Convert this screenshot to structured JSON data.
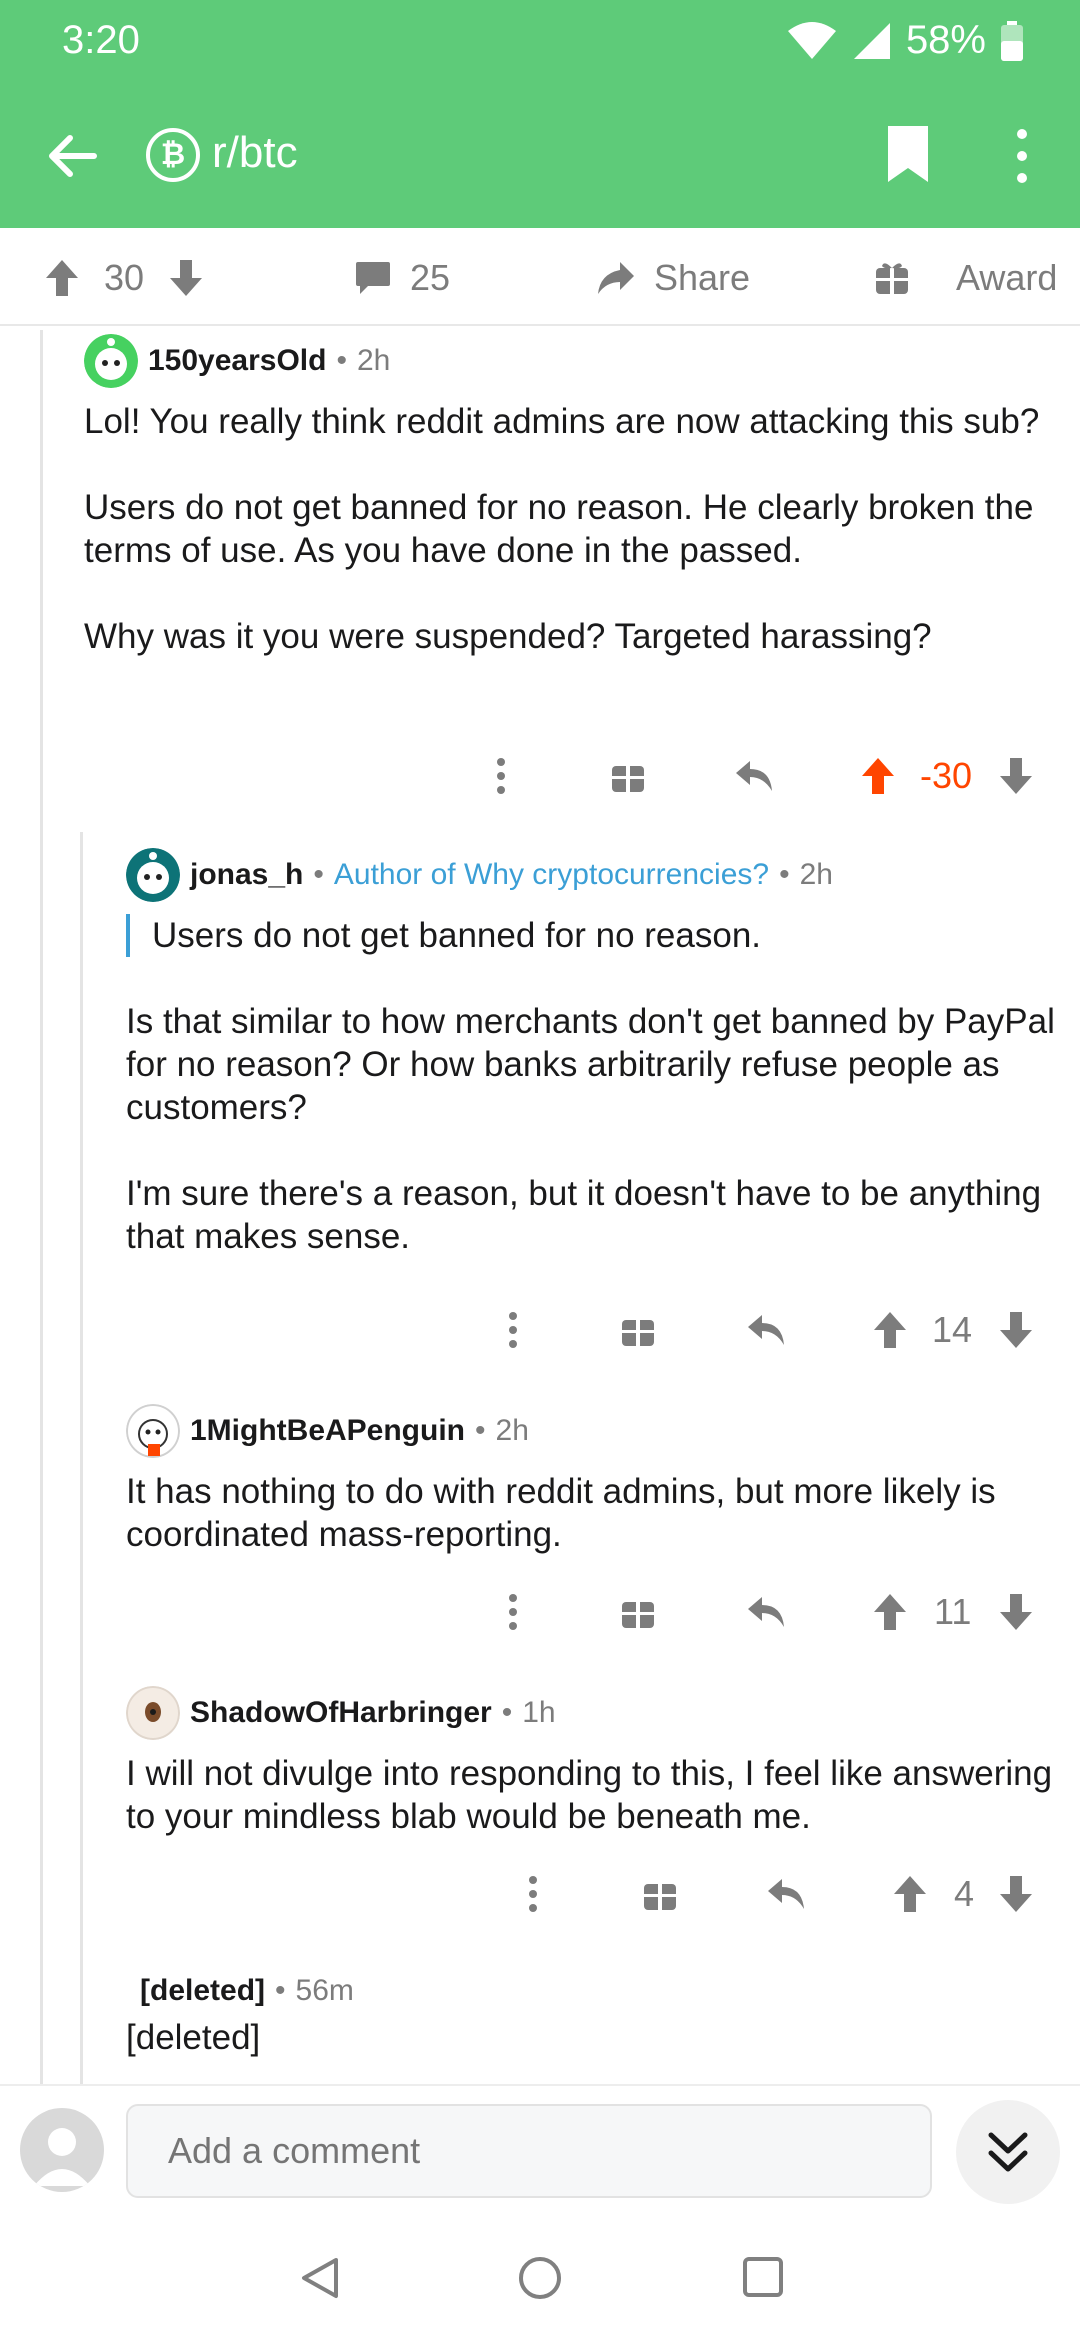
{
  "status": {
    "time": "3:20",
    "battery": "58%"
  },
  "appbar": {
    "subreddit": "r/btc",
    "badge_symbol": "₿",
    "back_icon": "arrow-left-icon",
    "bookmark_icon": "bookmark-icon",
    "more_icon": "more-vert-icon"
  },
  "postbar": {
    "score": "30",
    "comments": "25",
    "share_label": "Share",
    "award_label": "Award"
  },
  "comments": [
    {
      "user": "150yearsOld",
      "time": "2h",
      "paragraphs": [
        "Lol! You really think reddit admins are now attacking this sub?",
        "Users do not get banned for no reason. He clearly broken the terms of use. As you have done in the passed.",
        "Why was it you were suspended? Targeted harassing?"
      ],
      "score": "-30",
      "upvoted": true
    },
    {
      "user": "jonas_h",
      "flair": "Author of Why cryptocurrencies?",
      "time": "2h",
      "quote": "Users do not get banned for no reason.",
      "paragraphs": [
        "Is that similar to how merchants don't get banned by PayPal for no reason? Or how banks arbitrarily refuse people as customers?",
        "I'm sure there's a reason, but it doesn't have to be anything that makes sense."
      ],
      "score": "14"
    },
    {
      "user": "1MightBeAPenguin",
      "time": "2h",
      "paragraphs": [
        "It has nothing to do with reddit admins, but more likely is coordinated mass-reporting."
      ],
      "score": "11"
    },
    {
      "user": "ShadowOfHarbringer",
      "time": "1h",
      "paragraphs": [
        "I will not divulge into responding to this, I feel like answering to your mindless blab would be beneath me."
      ],
      "score": "4"
    },
    {
      "user": "[deleted]",
      "time": "56m",
      "paragraphs": [
        "[deleted]"
      ]
    }
  ],
  "composer": {
    "placeholder": "Add a comment"
  },
  "colors": {
    "brand_green": "#5ecb79",
    "upvote_orange": "#ff4500",
    "flair_blue": "#3b9fd6"
  }
}
